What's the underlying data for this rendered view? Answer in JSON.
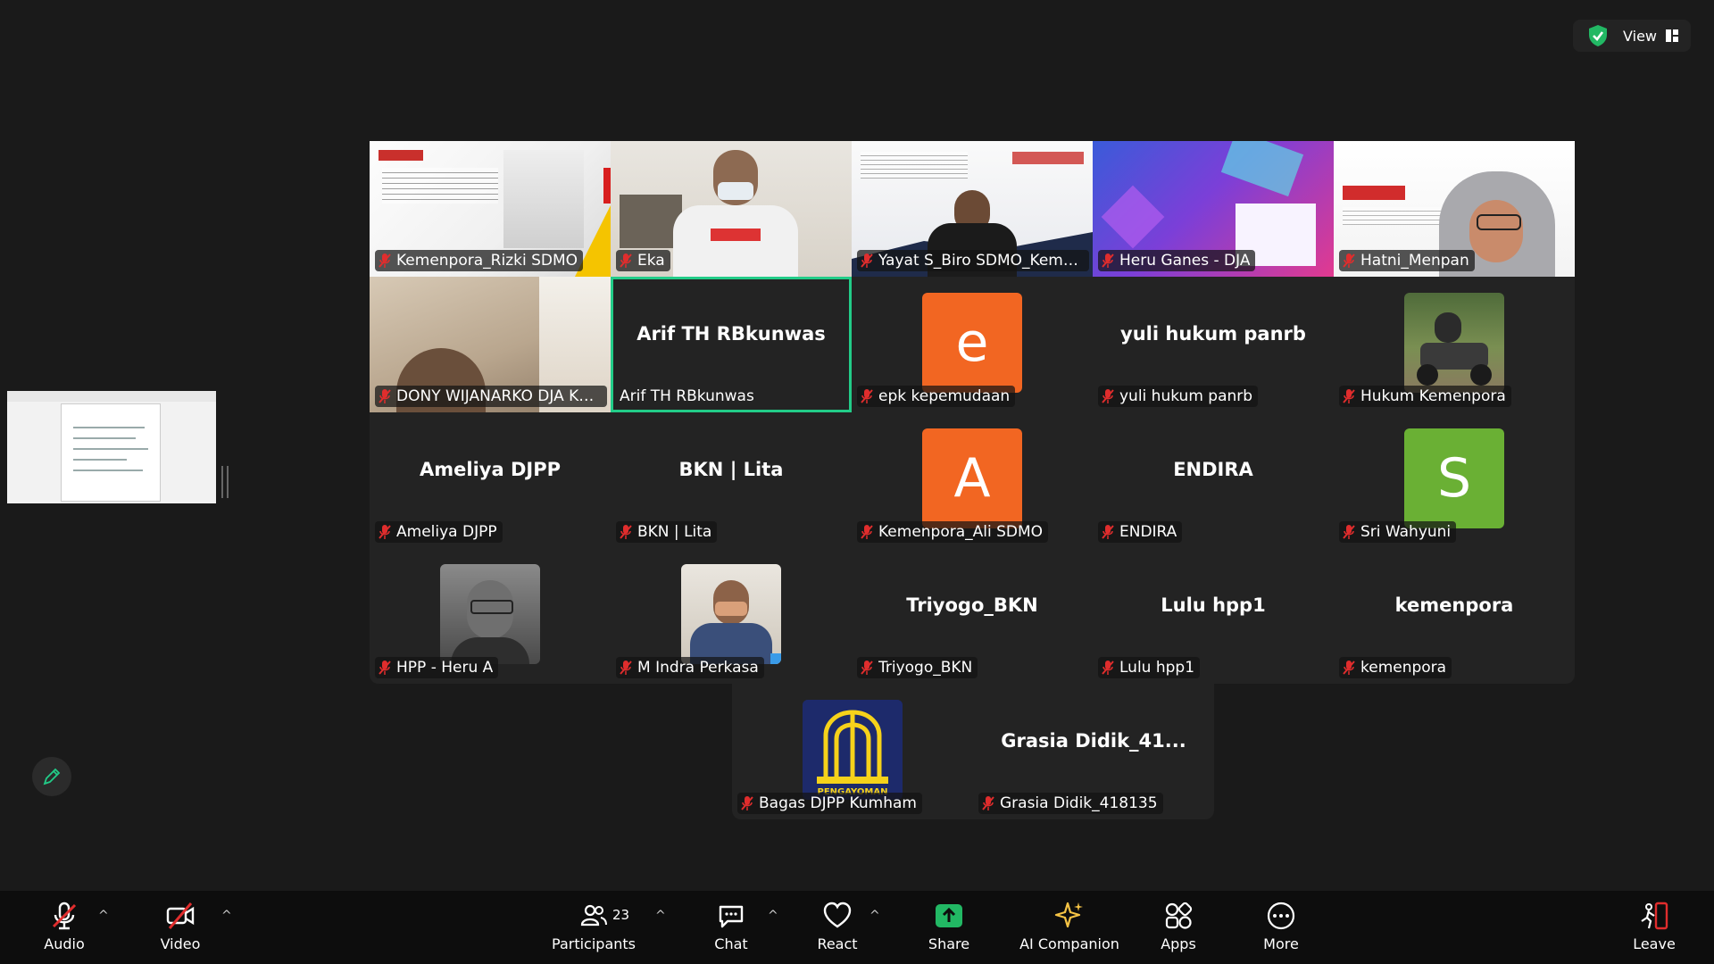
{
  "top": {
    "view_label": "View"
  },
  "tiles": [
    {
      "label": "Kemenpora_Rizki SDMO"
    },
    {
      "label": "Eka"
    },
    {
      "label": "Yayat S_Biro SDMO_Kemen..."
    },
    {
      "label": "Heru Ganes - DJA"
    },
    {
      "label": "Hatni_Menpan"
    },
    {
      "label": "DONY WIJANARKO DJA KE..."
    },
    {
      "label": "Arif TH RBkunwas",
      "name": "Arif TH RBkunwas"
    },
    {
      "label": "epk kepemudaan",
      "avatar": "e"
    },
    {
      "label": "yuli hukum panrb",
      "name": "yuli hukum panrb"
    },
    {
      "label": "Hukum Kemenpora"
    },
    {
      "label": "Ameliya DJPP",
      "name": "Ameliya DJPP"
    },
    {
      "label": "BKN | Lita",
      "name": "BKN | Lita"
    },
    {
      "label": "Kemenpora_Ali SDMO",
      "avatar": "A"
    },
    {
      "label": "ENDIRA",
      "name": "ENDIRA"
    },
    {
      "label": "Sri Wahyuni",
      "avatar": "S"
    },
    {
      "label": "HPP - Heru A"
    },
    {
      "label": "M Indra Perkasa"
    },
    {
      "label": "Triyogo_BKN",
      "name": "Triyogo_BKN"
    },
    {
      "label": "Lulu hpp1",
      "name": "Lulu hpp1"
    },
    {
      "label": "kemenpora",
      "name": "kemenpora"
    },
    {
      "label": "Bagas DJPP Kumham",
      "logo_text": "PENGAYOMAN"
    },
    {
      "label": "Grasia Didik_418135",
      "name": "Grasia Didik_41..."
    }
  ],
  "colors": {
    "accent_green": "#22cc88",
    "avatar_orange": "#f26622",
    "avatar_green": "#6ab034",
    "mute_red": "#e02d2d",
    "share_green": "#22b864"
  },
  "toolbar": {
    "audio": "Audio",
    "video": "Video",
    "participants": "Participants",
    "participants_count": "23",
    "chat": "Chat",
    "react": "React",
    "share": "Share",
    "ai_companion": "AI Companion",
    "apps": "Apps",
    "more": "More",
    "leave": "Leave"
  }
}
